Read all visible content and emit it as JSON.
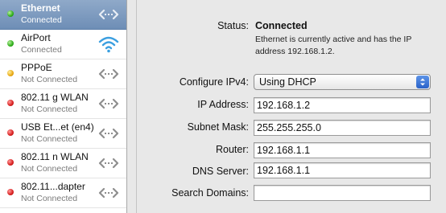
{
  "services": [
    {
      "name": "Ethernet",
      "status": "Connected",
      "status_color": "#2fae1a",
      "icon": "ethernet-icon",
      "selected": true
    },
    {
      "name": "AirPort",
      "status": "Connected",
      "status_color": "#2fae1a",
      "icon": "wifi-icon",
      "selected": false
    },
    {
      "name": "PPPoE",
      "status": "Not Connected",
      "status_color": "#e9a915",
      "icon": "ethernet-icon",
      "selected": false
    },
    {
      "name": "802.11 g WLAN",
      "status": "Not Connected",
      "status_color": "#d81f1f",
      "icon": "ethernet-icon",
      "selected": false
    },
    {
      "name": "USB Et...et (en4)",
      "status": "Not Connected",
      "status_color": "#d81f1f",
      "icon": "ethernet-icon",
      "selected": false
    },
    {
      "name": "802.11 n WLAN",
      "status": "Not Connected",
      "status_color": "#d81f1f",
      "icon": "ethernet-icon",
      "selected": false
    },
    {
      "name": "802.11...dapter",
      "status": "Not Connected",
      "status_color": "#d81f1f",
      "icon": "ethernet-icon",
      "selected": false
    }
  ],
  "detail": {
    "status_label": "Status:",
    "status_value": "Connected",
    "status_description": "Ethernet is currently active and has the IP address 192.168.1.2.",
    "configure_label": "Configure IPv4:",
    "configure_value": "Using DHCP",
    "ip_label": "IP Address:",
    "ip_value": "192.168.1.2",
    "subnet_label": "Subnet Mask:",
    "subnet_value": "255.255.255.0",
    "router_label": "Router:",
    "router_value": "192.168.1.1",
    "dns_label": "DNS Server:",
    "dns_value": "192.168.1.1",
    "search_label": "Search Domains:",
    "search_value": ""
  },
  "colors": {
    "selection": "#7f9cc1",
    "connected": "#2fae1a",
    "pending": "#e9a915",
    "disconnected": "#d81f1f",
    "popup_arrow": "#2a62c8"
  }
}
